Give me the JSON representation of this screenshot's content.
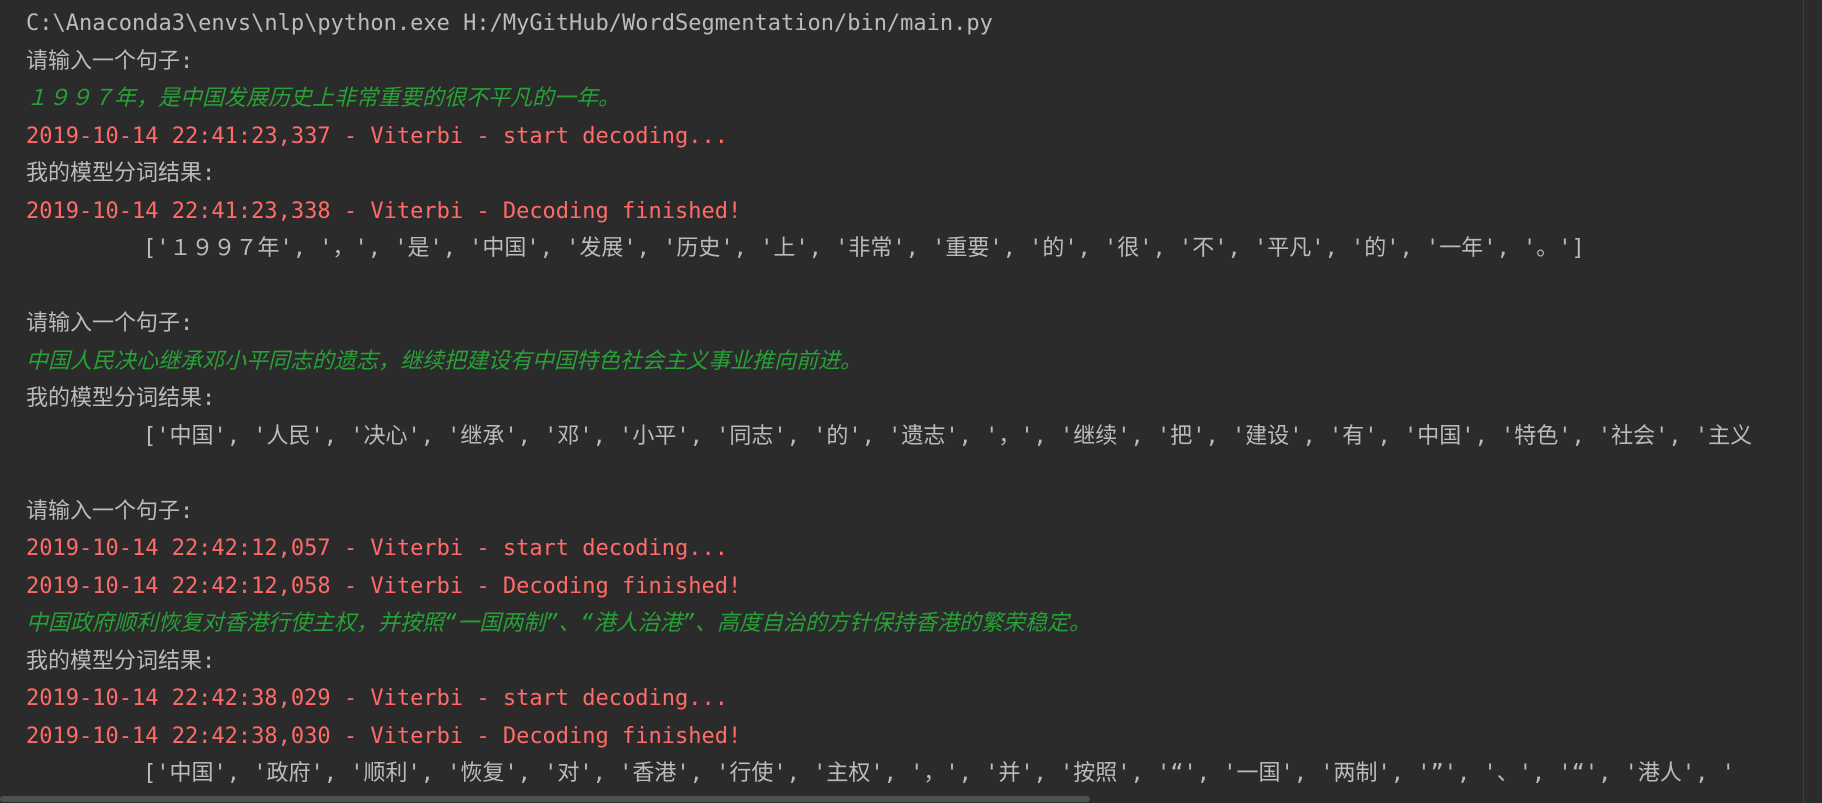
{
  "console": {
    "lines": [
      {
        "kind": "std",
        "text": "C:\\Anaconda3\\envs\\nlp\\python.exe H:/MyGitHub/WordSegmentation/bin/main.py"
      },
      {
        "kind": "std",
        "text": "请输入一个句子:"
      },
      {
        "kind": "inp",
        "text": "１９９７年，是中国发展历史上非常重要的很不平凡的一年。"
      },
      {
        "kind": "err",
        "text": "2019-10-14 22:41:23,337 - Viterbi - start decoding..."
      },
      {
        "kind": "std",
        "text": "我的模型分词结果:"
      },
      {
        "kind": "err",
        "text": "2019-10-14 22:41:23,338 - Viterbi - Decoding finished!"
      },
      {
        "kind": "res",
        "text": "['１９９７年', '，', '是', '中国', '发展', '历史', '上', '非常', '重要', '的', '很', '不', '平凡', '的', '一年', '。']"
      },
      {
        "kind": "blank",
        "text": ""
      },
      {
        "kind": "std",
        "text": "请输入一个句子:"
      },
      {
        "kind": "inp",
        "text": "中国人民决心继承邓小平同志的遗志，继续把建设有中国特色社会主义事业推向前进。"
      },
      {
        "kind": "std",
        "text": "我的模型分词结果:"
      },
      {
        "kind": "res",
        "text": "['中国', '人民', '决心', '继承', '邓', '小平', '同志', '的', '遗志', '，', '继续', '把', '建设', '有', '中国', '特色', '社会', '主义"
      },
      {
        "kind": "blank",
        "text": ""
      },
      {
        "kind": "std",
        "text": "请输入一个句子:"
      },
      {
        "kind": "err",
        "text": "2019-10-14 22:42:12,057 - Viterbi - start decoding..."
      },
      {
        "kind": "err",
        "text": "2019-10-14 22:42:12,058 - Viterbi - Decoding finished!"
      },
      {
        "kind": "inp",
        "text": "中国政府顺利恢复对香港行使主权，并按照“一国两制”、“港人治港”、高度自治的方针保持香港的繁荣稳定。"
      },
      {
        "kind": "std",
        "text": "我的模型分词结果:"
      },
      {
        "kind": "err",
        "text": "2019-10-14 22:42:38,029 - Viterbi - start decoding..."
      },
      {
        "kind": "err",
        "text": "2019-10-14 22:42:38,030 - Viterbi - Decoding finished!"
      },
      {
        "kind": "res",
        "text": "['中国', '政府', '顺利', '恢复', '对', '香港', '行使', '主权', '，', '并', '按照', '“', '一国', '两制', '”', '、', '“', '港人', '"
      }
    ]
  },
  "colors": {
    "background": "#2b2b2b",
    "stdout": "#bbbbbb",
    "stderr": "#ff6b68",
    "user_input": "#27a136"
  }
}
